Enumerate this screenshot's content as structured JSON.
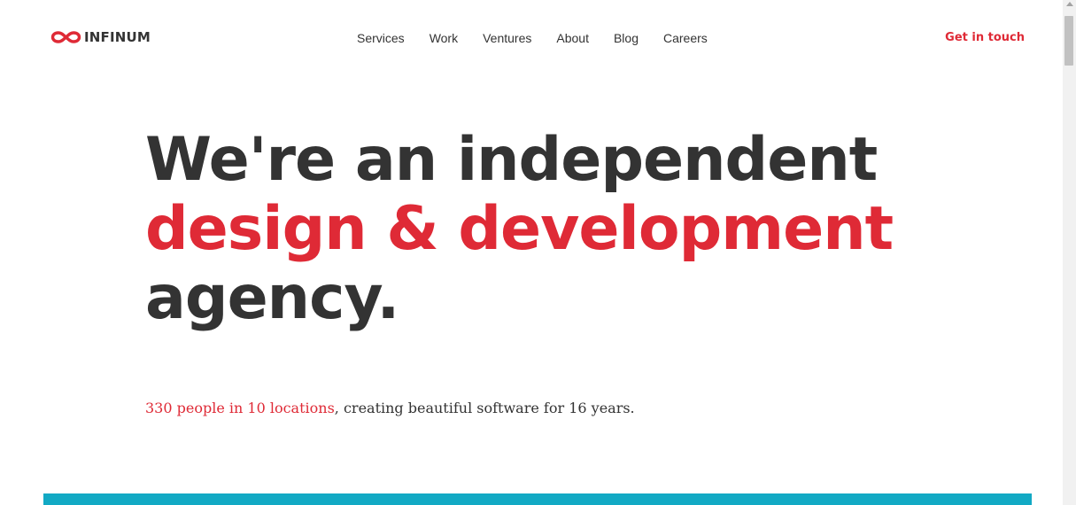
{
  "header": {
    "logo_text": "INFINUM",
    "logo_icon": "infinity-icon",
    "nav": [
      {
        "label": "Services"
      },
      {
        "label": "Work"
      },
      {
        "label": "Ventures"
      },
      {
        "label": "About"
      },
      {
        "label": "Blog"
      },
      {
        "label": "Careers"
      }
    ],
    "cta_label": "Get in touch"
  },
  "hero": {
    "line1": "We're an independent",
    "line2": "design & development",
    "line3": "agency."
  },
  "tagline": {
    "link_text": "330 people in 10 locations",
    "rest": ", creating beautiful software for 16 years."
  },
  "colors": {
    "accent": "#df2a36",
    "text": "#333333",
    "teal": "#12a9c4"
  }
}
